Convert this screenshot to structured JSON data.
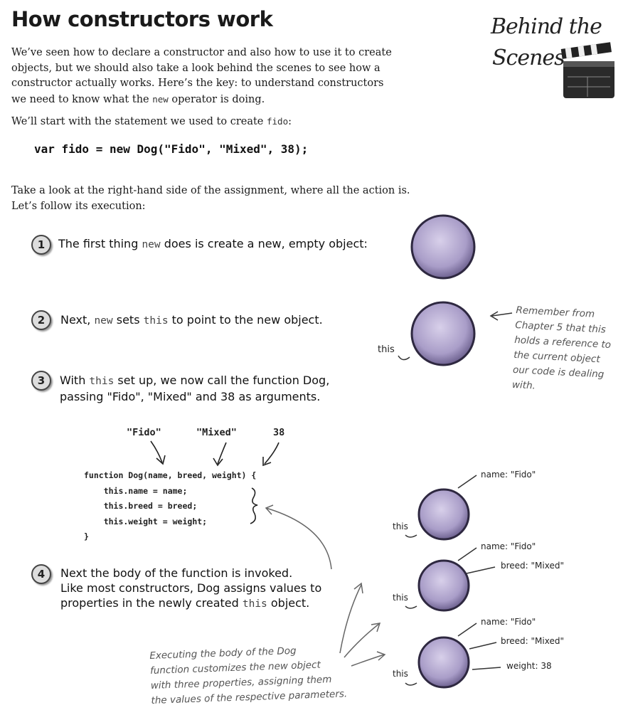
{
  "title": "How constructors work",
  "intro": {
    "text_before": "We’ve seen how to declare a constructor and also how to use it to create objects, but we should also take a look behind the scenes to see how a constructor actually works. Here’s the key: to understand constructors we need to know what the ",
    "code": "new",
    "text_after": " operator is doing."
  },
  "start": {
    "text": "We’ll start with the statement we used to create ",
    "code": "fido",
    "end": ":"
  },
  "statement": "var fido = new Dog(\"Fido\", \"Mixed\", 38);",
  "rhs": {
    "line1": "Take a look at the right-hand side of the assignment, where all the action is.",
    "line2": "Let’s follow its execution:"
  },
  "behind": {
    "line1": "Behind the",
    "line2": "Scenes"
  },
  "steps": [
    {
      "num": "1",
      "a": "The first thing ",
      "code": "new",
      "b": " does is create a new, empty object:"
    },
    {
      "num": "2",
      "a": "Next, ",
      "code": "new",
      "b": " sets ",
      "code2": "this",
      "c": " to point to the new object."
    },
    {
      "num": "3",
      "a": "With ",
      "code": "this",
      "b": " set up, we now call the function Dog,",
      "line2": "passing \"Fido\", \"Mixed\" and 38 as arguments."
    },
    {
      "num": "4",
      "line1": "Next the body of the function is invoked.",
      "line2": "Like most constructors, Dog assigns values to",
      "line3a": "properties in the newly created ",
      "code": "this",
      "line3b": " object."
    }
  ],
  "note_this": [
    "Remember from",
    "Chapter 5 that this",
    "holds a reference to",
    "the current object",
    "our code is dealing",
    "with."
  ],
  "args": [
    "\"Fido\"",
    "\"Mixed\"",
    "38"
  ],
  "code_lines": [
    "function Dog(name, breed, weight) {",
    "    this.name = name;",
    "    this.breed = breed;",
    "    this.weight = weight;",
    "}"
  ],
  "this_label": "this",
  "props": {
    "name": "name: \"Fido\"",
    "breed": "breed: \"Mixed\"",
    "weight": "weight:  38"
  },
  "note_body": [
    "Executing the body of the Dog",
    "function customizes the new object",
    "with three properties, assigning them",
    "the values of the respective parameters."
  ]
}
